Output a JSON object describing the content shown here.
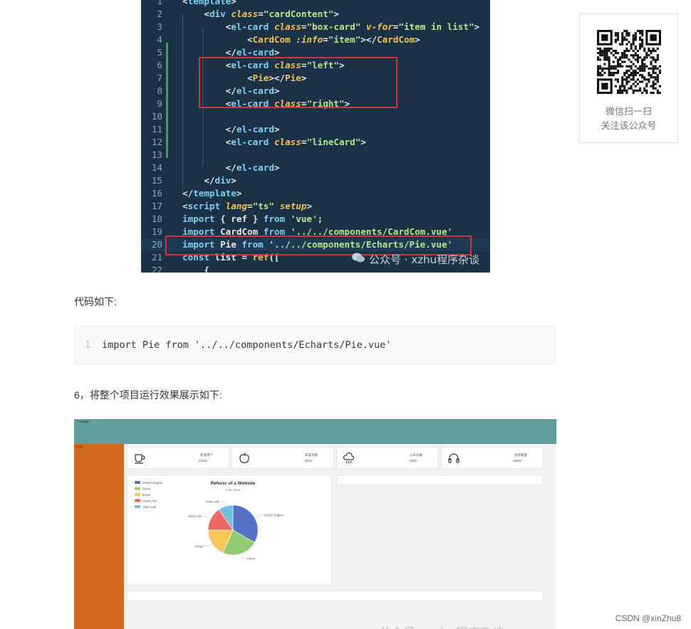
{
  "code_screenshot": {
    "lines": [
      {
        "n": "1",
        "tokens": [
          [
            "punc",
            "<"
          ],
          [
            "tag",
            "template"
          ],
          [
            "punc",
            ">"
          ]
        ]
      },
      {
        "n": "2",
        "tokens": [
          [
            "plain",
            "    "
          ],
          [
            "punc",
            "<"
          ],
          [
            "tag",
            "div"
          ],
          [
            "plain",
            " "
          ],
          [
            "attr",
            "class"
          ],
          [
            "punc",
            "="
          ],
          [
            "str",
            "\"cardContent\""
          ],
          [
            "punc",
            ">"
          ]
        ]
      },
      {
        "n": "3",
        "tokens": [
          [
            "plain",
            "        "
          ],
          [
            "punc",
            "<"
          ],
          [
            "tag",
            "el-card"
          ],
          [
            "plain",
            " "
          ],
          [
            "attr",
            "class"
          ],
          [
            "punc",
            "="
          ],
          [
            "str",
            "\"box-card\""
          ],
          [
            "plain",
            " "
          ],
          [
            "attr",
            "v-for"
          ],
          [
            "punc",
            "="
          ],
          [
            "str",
            "\"item in list\""
          ],
          [
            "punc",
            ">"
          ]
        ]
      },
      {
        "n": "4",
        "tokens": [
          [
            "plain",
            "            "
          ],
          [
            "punc",
            "<"
          ],
          [
            "comp",
            "CardCom"
          ],
          [
            "plain",
            " "
          ],
          [
            "attr",
            ":info"
          ],
          [
            "punc",
            "="
          ],
          [
            "str",
            "\"item\""
          ],
          [
            "punc",
            "></"
          ],
          [
            "comp",
            "CardCom"
          ],
          [
            "punc",
            ">"
          ]
        ]
      },
      {
        "n": "5",
        "tokens": [
          [
            "plain",
            "        "
          ],
          [
            "punc",
            "</"
          ],
          [
            "tag",
            "el-card"
          ],
          [
            "punc",
            ">"
          ]
        ]
      },
      {
        "n": "6",
        "tokens": [
          [
            "plain",
            "        "
          ],
          [
            "punc",
            "<"
          ],
          [
            "tag",
            "el-card"
          ],
          [
            "plain",
            " "
          ],
          [
            "attr",
            "class"
          ],
          [
            "punc",
            "="
          ],
          [
            "str",
            "\"left\""
          ],
          [
            "punc",
            ">"
          ]
        ]
      },
      {
        "n": "7",
        "tokens": [
          [
            "plain",
            "            "
          ],
          [
            "punc",
            "<"
          ],
          [
            "comp",
            "Pie"
          ],
          [
            "punc",
            "></"
          ],
          [
            "comp",
            "Pie"
          ],
          [
            "punc",
            ">"
          ]
        ]
      },
      {
        "n": "8",
        "tokens": [
          [
            "plain",
            "        "
          ],
          [
            "punc",
            "</"
          ],
          [
            "tag",
            "el-card"
          ],
          [
            "punc",
            ">"
          ]
        ]
      },
      {
        "n": "9",
        "tokens": [
          [
            "plain",
            "        "
          ],
          [
            "punc",
            "<"
          ],
          [
            "tag",
            "el-card"
          ],
          [
            "plain",
            " "
          ],
          [
            "attr",
            "class"
          ],
          [
            "punc",
            "="
          ],
          [
            "str",
            "\"right\""
          ],
          [
            "punc",
            ">"
          ]
        ]
      },
      {
        "n": "10",
        "tokens": []
      },
      {
        "n": "11",
        "tokens": [
          [
            "plain",
            "        "
          ],
          [
            "punc",
            "</"
          ],
          [
            "tag",
            "el-card"
          ],
          [
            "punc",
            ">"
          ]
        ]
      },
      {
        "n": "12",
        "tokens": [
          [
            "plain",
            "        "
          ],
          [
            "punc",
            "<"
          ],
          [
            "tag",
            "el-card"
          ],
          [
            "plain",
            " "
          ],
          [
            "attr",
            "class"
          ],
          [
            "punc",
            "="
          ],
          [
            "str",
            "\"lineCard\""
          ],
          [
            "punc",
            ">"
          ]
        ]
      },
      {
        "n": "13",
        "tokens": []
      },
      {
        "n": "14",
        "tokens": [
          [
            "plain",
            "        "
          ],
          [
            "punc",
            "</"
          ],
          [
            "tag",
            "el-card"
          ],
          [
            "punc",
            ">"
          ]
        ]
      },
      {
        "n": "15",
        "tokens": [
          [
            "plain",
            "    "
          ],
          [
            "punc",
            "</"
          ],
          [
            "tag",
            "div"
          ],
          [
            "punc",
            ">"
          ]
        ]
      },
      {
        "n": "16",
        "tokens": [
          [
            "punc",
            "</"
          ],
          [
            "tag",
            "template"
          ],
          [
            "punc",
            ">"
          ]
        ]
      },
      {
        "n": "17",
        "tokens": [
          [
            "punc",
            "<"
          ],
          [
            "tag",
            "script"
          ],
          [
            "plain",
            " "
          ],
          [
            "attr",
            "lang"
          ],
          [
            "punc",
            "="
          ],
          [
            "str",
            "\"ts\""
          ],
          [
            "plain",
            " "
          ],
          [
            "attr",
            "setup"
          ],
          [
            "punc",
            ">"
          ]
        ]
      },
      {
        "n": "18",
        "tokens": [
          [
            "tag",
            "import"
          ],
          [
            "plain",
            " { ref } "
          ],
          [
            "tag",
            "from"
          ],
          [
            "plain",
            " "
          ],
          [
            "str",
            "'vue'"
          ],
          [
            "plain",
            ";"
          ]
        ]
      },
      {
        "n": "19",
        "tokens": [
          [
            "tag",
            "import"
          ],
          [
            "plain",
            " CardCom "
          ],
          [
            "tag",
            "from"
          ],
          [
            "plain",
            " "
          ],
          [
            "str",
            "'../../components/CardCom.vue'"
          ]
        ]
      },
      {
        "n": "20",
        "tokens": [
          [
            "tag",
            "import"
          ],
          [
            "plain",
            " Pie "
          ],
          [
            "tag",
            "from"
          ],
          [
            "plain",
            " "
          ],
          [
            "str",
            "'../../components/Echarts/Pie.vue'"
          ]
        ]
      },
      {
        "n": "21",
        "tokens": [
          [
            "tag",
            "const"
          ],
          [
            "plain",
            " list = "
          ],
          [
            "comp",
            "ref"
          ],
          [
            "plain",
            "(["
          ]
        ]
      },
      {
        "n": "22",
        "tokens": [
          [
            "plain",
            "    {"
          ]
        ]
      }
    ],
    "watermark": "公众号 · xzhu程序杂谈"
  },
  "qr_card": {
    "caption_line1": "微信扫一扫",
    "caption_line2": "关注该公众号"
  },
  "article": {
    "intro": "代码如下:",
    "code_line_number": "1",
    "code_line": "import Pie from '../../components/Echarts/Pie.vue'",
    "step6": "6，将整个项目运行效果展示如下:"
  },
  "app_screenshot": {
    "header_label": "Header",
    "aside_label": "Aside",
    "stats": [
      {
        "icon": "cup-icon",
        "label": "新增用户",
        "value": "10291"
      },
      {
        "icon": "apple-icon",
        "label": "未成年数",
        "value": "8812"
      },
      {
        "icon": "cloud-rain-icon",
        "label": "公众号数",
        "value": "9280"
      },
      {
        "icon": "headphones-icon",
        "label": "消息数量",
        "value": "13600"
      }
    ],
    "pie_title": "Referer of a Website",
    "pie_subtitle": "Fake Data",
    "legend": [
      {
        "name": "Search Engine",
        "color": "#5470c6"
      },
      {
        "name": "Direct",
        "color": "#91cc75"
      },
      {
        "name": "Email",
        "color": "#fac858"
      },
      {
        "name": "Union Ads",
        "color": "#ee6666"
      },
      {
        "name": "Video Ads",
        "color": "#73c0de"
      }
    ],
    "watermark": "公众号 · xzhu程序杂谈"
  },
  "chart_data": {
    "type": "pie",
    "title": "Referer of a Website",
    "subtitle": "Fake Data",
    "categories": [
      "Search Engine",
      "Direct",
      "Email",
      "Union Ads",
      "Video Ads"
    ],
    "values": [
      1048,
      735,
      580,
      484,
      300
    ],
    "colors": [
      "#5470c6",
      "#91cc75",
      "#fac858",
      "#ee6666",
      "#73c0de"
    ],
    "legend_position": "top-left"
  },
  "footer": {
    "credit": "CSDN @xinZhu8"
  }
}
